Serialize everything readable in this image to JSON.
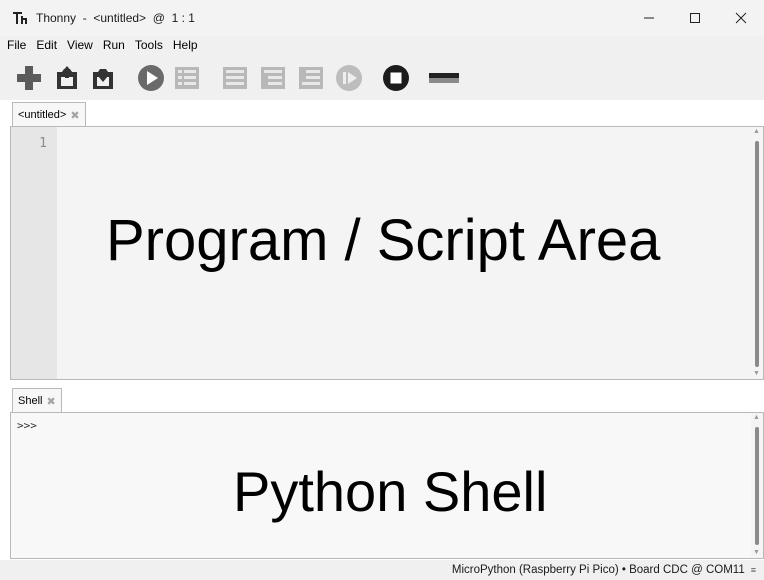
{
  "window": {
    "title": "Thonny  -  <untitled>  @  1 : 1",
    "controls": {
      "minimize": "—",
      "maximize": "☐",
      "close": "✕"
    }
  },
  "menu": [
    "File",
    "Edit",
    "View",
    "Run",
    "Tools",
    "Help"
  ],
  "toolbar": {
    "buttons": [
      {
        "name": "new-file-icon",
        "enabled": true
      },
      {
        "name": "open-file-icon",
        "enabled": true
      },
      {
        "name": "save-file-icon",
        "enabled": true
      },
      {
        "name": "run-icon",
        "enabled": true
      },
      {
        "name": "debug-icon",
        "enabled": false
      },
      {
        "name": "step-over-icon",
        "enabled": false
      },
      {
        "name": "step-into-icon",
        "enabled": false
      },
      {
        "name": "step-out-icon",
        "enabled": false
      },
      {
        "name": "resume-icon",
        "enabled": false
      },
      {
        "name": "stop-icon",
        "enabled": true
      },
      {
        "name": "zoom-icon",
        "enabled": true
      }
    ]
  },
  "editor": {
    "tab_label": "<untitled>",
    "tab_close": "✖",
    "line_numbers": [
      "1"
    ],
    "label": "Program / Script Area"
  },
  "shell": {
    "tab_label": "Shell",
    "tab_close": "✖",
    "prompt": ">>>",
    "label": "Python Shell"
  },
  "status": {
    "text": "MicroPython (Raspberry Pi Pico)  •  Board CDC @ COM11",
    "grip": "≡"
  }
}
